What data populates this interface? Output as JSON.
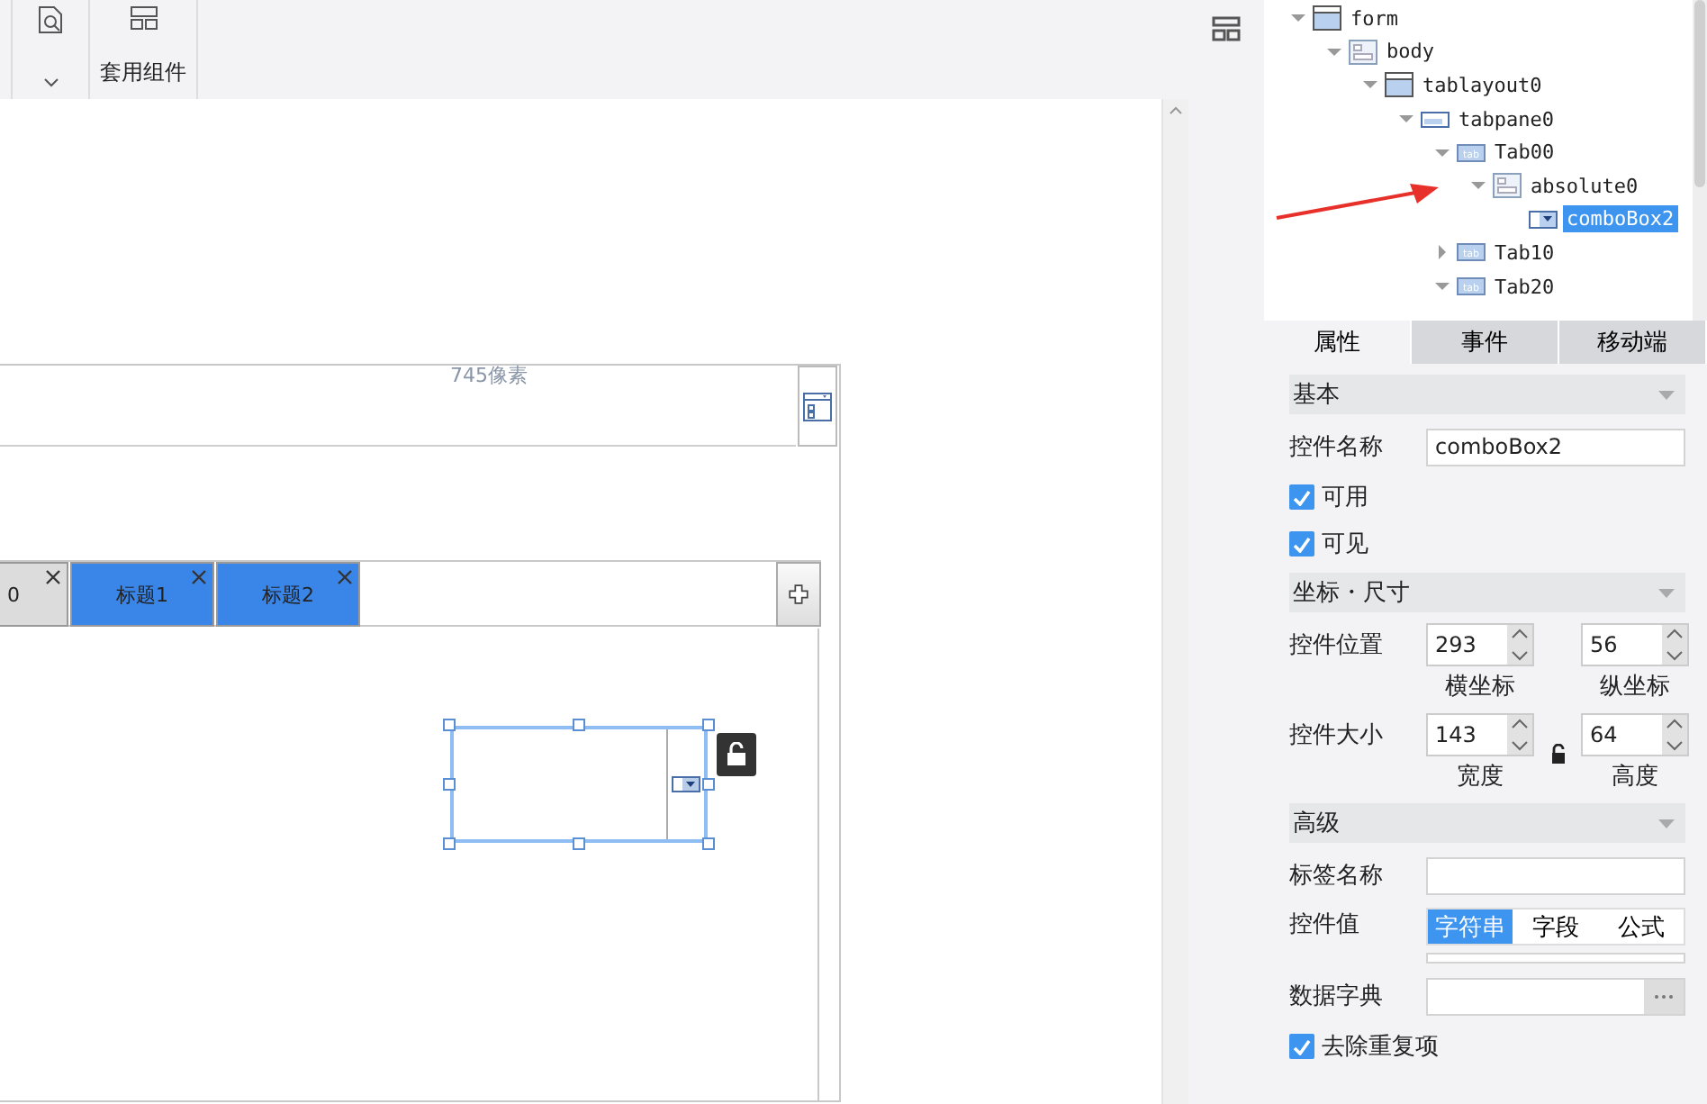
{
  "toolbar": {
    "component_label": "套用组件"
  },
  "canvas": {
    "width_label": "745像素",
    "tabs": [
      {
        "label": "0",
        "color": "#dcdcdc"
      },
      {
        "label": "标题1",
        "color": "#3a86e8"
      },
      {
        "label": "标题2",
        "color": "#3a86e8"
      }
    ]
  },
  "tree": [
    {
      "label": "form",
      "kind": "form",
      "expanded": true,
      "selected": false,
      "children": [
        {
          "label": "body",
          "kind": "panel",
          "expanded": true,
          "selected": false,
          "children": [
            {
              "label": "tablayout0",
              "kind": "form",
              "expanded": true,
              "selected": false,
              "children": [
                {
                  "label": "tabpane0",
                  "kind": "tabpane",
                  "expanded": true,
                  "selected": false,
                  "children": [
                    {
                      "label": "Tab00",
                      "kind": "tab",
                      "expanded": true,
                      "selected": false,
                      "children": [
                        {
                          "label": "absolute0",
                          "kind": "panel",
                          "expanded": true,
                          "selected": false,
                          "children": [
                            {
                              "label": "comboBox2",
                              "kind": "combo",
                              "selected": true
                            }
                          ]
                        }
                      ]
                    },
                    {
                      "label": "Tab10",
                      "kind": "tab",
                      "expanded": false,
                      "selected": false
                    },
                    {
                      "label": "Tab20",
                      "kind": "tab",
                      "expanded": true,
                      "selected": false
                    }
                  ]
                }
              ]
            }
          ]
        }
      ]
    }
  ],
  "property_tabs": [
    {
      "label": "属性",
      "selected": true
    },
    {
      "label": "事件",
      "selected": false
    },
    {
      "label": "移动端",
      "selected": false
    }
  ],
  "sections": [
    {
      "title": "基本",
      "rows": [
        {
          "kind": "text",
          "label": "控件名称",
          "value": "comboBox2"
        },
        {
          "kind": "checkbox",
          "label": "可用",
          "checked": true
        },
        {
          "kind": "checkbox",
          "label": "可见",
          "checked": true
        }
      ]
    },
    {
      "title": "坐标・尺寸",
      "rows": [
        {
          "kind": "pair",
          "label": "控件位置",
          "fields": [
            {
              "value": "293",
              "caption": "横坐标"
            },
            {
              "value": "56",
              "caption": "纵坐标"
            }
          ]
        },
        {
          "kind": "pair",
          "label": "控件大小",
          "locked": false,
          "fields": [
            {
              "value": "143",
              "caption": "宽度"
            },
            {
              "value": "64",
              "caption": "高度"
            }
          ]
        }
      ]
    },
    {
      "title": "高级",
      "rows": [
        {
          "kind": "text",
          "label": "标签名称"
        },
        {
          "kind": "segmented",
          "label": "控件值",
          "options": [
            {
              "label": "字符串",
              "selected": true
            },
            {
              "label": "字段",
              "selected": false
            },
            {
              "label": "公式",
              "selected": false
            }
          ]
        },
        {
          "kind": "picker",
          "label": "数据字典"
        },
        {
          "kind": "checkbox",
          "label": "去除重复项",
          "checked": true
        }
      ]
    }
  ]
}
